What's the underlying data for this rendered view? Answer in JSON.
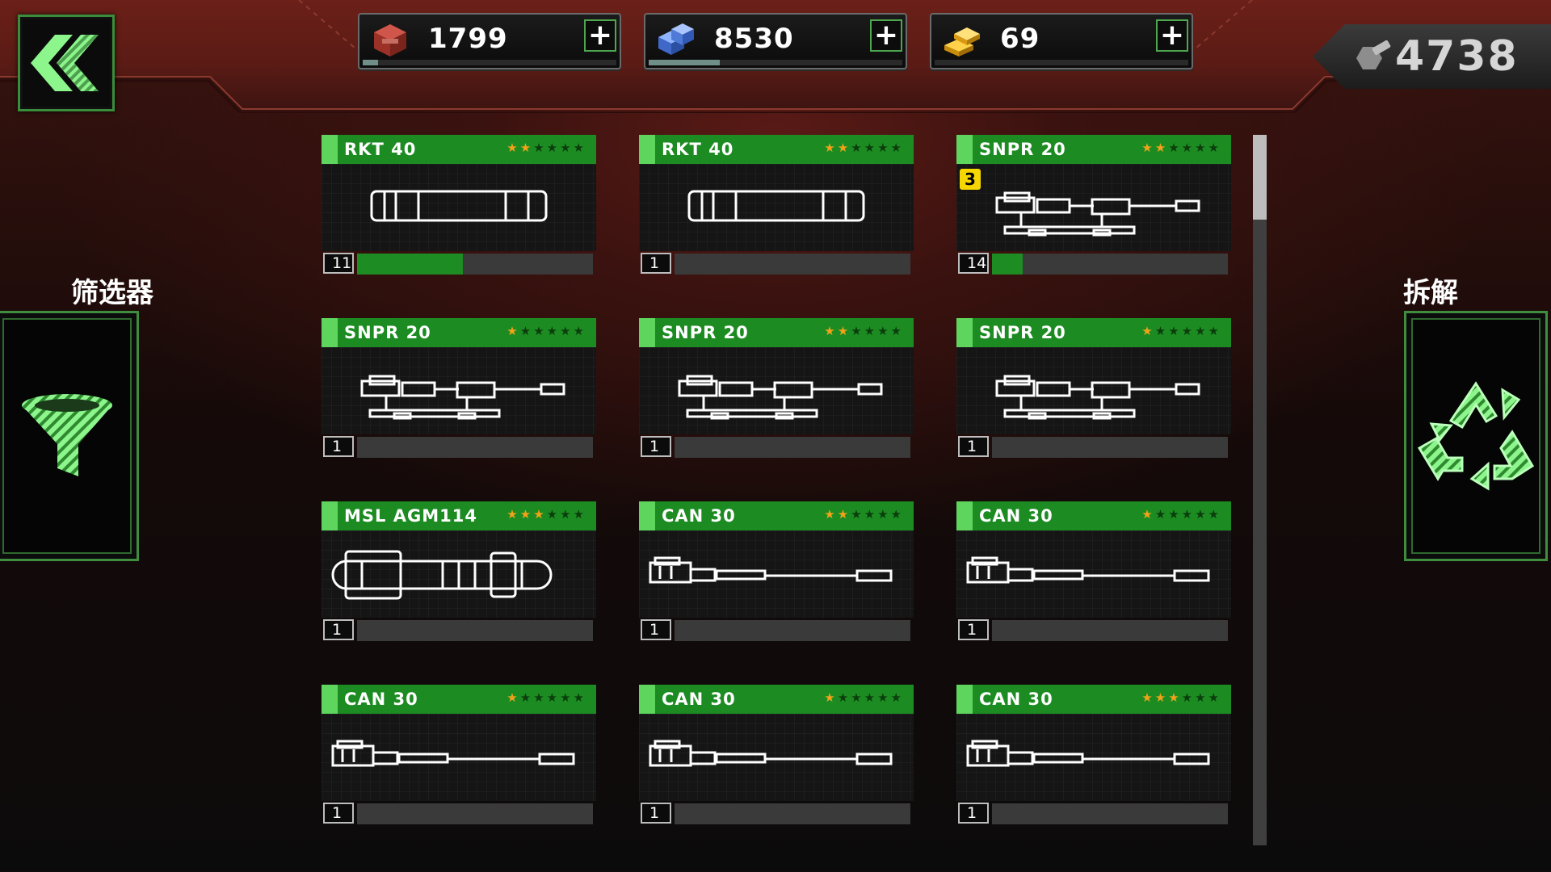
{
  "resources": [
    {
      "icon": "red-crate-icon",
      "value": "1799",
      "add_label": "+",
      "progress": 0.06
    },
    {
      "icon": "blue-crates-icon",
      "value": "8530",
      "add_label": "+",
      "progress": 0.28
    },
    {
      "icon": "gold-bars-icon",
      "value": "69",
      "add_label": "+",
      "progress": 0
    }
  ],
  "parts": {
    "icon": "bolt-nut-icon",
    "value": "4738"
  },
  "filter": {
    "label": "筛选器",
    "icon": "funnel-icon"
  },
  "dismantle": {
    "label": "拆解",
    "icon": "recycle-icon"
  },
  "colors": {
    "accent": "#1c8c22",
    "star_on": "#f3a21a",
    "badge": "#f5d600"
  },
  "weapons": [
    {
      "name": "RKT 40",
      "stars": 2,
      "level": "11",
      "xp": 0.45,
      "type": "rocket",
      "badge": ""
    },
    {
      "name": "RKT 40",
      "stars": 2,
      "level": "1",
      "xp": 0,
      "type": "rocket",
      "badge": ""
    },
    {
      "name": "SNPR 20",
      "stars": 2,
      "level": "14",
      "xp": 0.13,
      "type": "sniper",
      "badge": "3"
    },
    {
      "name": "SNPR 20",
      "stars": 1,
      "level": "1",
      "xp": 0,
      "type": "sniper",
      "badge": ""
    },
    {
      "name": "SNPR 20",
      "stars": 2,
      "level": "1",
      "xp": 0,
      "type": "sniper",
      "badge": ""
    },
    {
      "name": "SNPR 20",
      "stars": 1,
      "level": "1",
      "xp": 0,
      "type": "sniper",
      "badge": ""
    },
    {
      "name": "MSL AGM114",
      "stars": 3,
      "level": "1",
      "xp": 0,
      "type": "missile",
      "badge": ""
    },
    {
      "name": "CAN 30",
      "stars": 2,
      "level": "1",
      "xp": 0,
      "type": "cannon",
      "badge": ""
    },
    {
      "name": "CAN 30",
      "stars": 1,
      "level": "1",
      "xp": 0,
      "type": "cannon",
      "badge": ""
    },
    {
      "name": "CAN 30",
      "stars": 1,
      "level": "1",
      "xp": 0,
      "type": "cannon",
      "badge": ""
    },
    {
      "name": "CAN 30",
      "stars": 1,
      "level": "1",
      "xp": 0,
      "type": "cannon",
      "badge": ""
    },
    {
      "name": "CAN 30",
      "stars": 3,
      "level": "1",
      "xp": 0,
      "type": "cannon",
      "badge": ""
    }
  ],
  "scroll_position": 0
}
